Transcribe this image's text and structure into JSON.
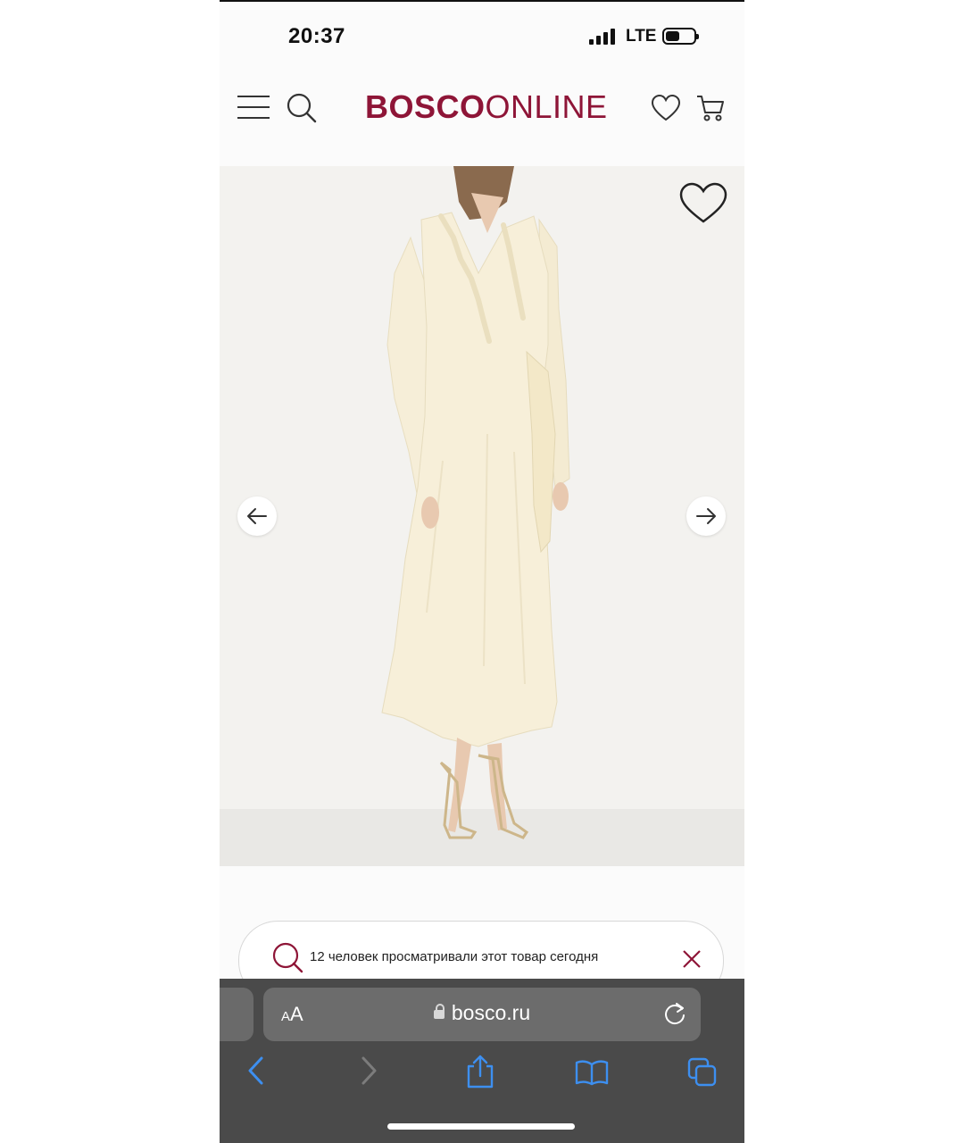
{
  "status_bar": {
    "time": "20:37",
    "network": "LTE"
  },
  "header": {
    "logo_bold": "BOSCO",
    "logo_light": "ONLINE",
    "brand_color": "#8e1537",
    "icons": [
      "menu-icon",
      "search-icon",
      "heart-icon",
      "cart-icon"
    ]
  },
  "product": {
    "image_alt_icons": [
      "favorite-heart-icon",
      "arrow-left-icon",
      "arrow-right-icon"
    ]
  },
  "popup": {
    "text": "12 человек просматривали этот товар сегодня"
  },
  "browser": {
    "aa_small": "A",
    "aa_large": "A",
    "url": "bosco.ru",
    "toolbar_icons": [
      "back-icon",
      "forward-icon",
      "share-icon",
      "bookmarks-icon",
      "tabs-icon"
    ]
  }
}
